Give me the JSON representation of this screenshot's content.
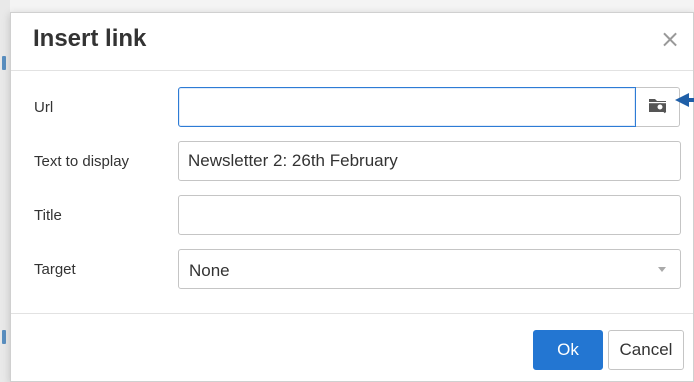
{
  "dialog": {
    "title": "Insert link",
    "close_symbol": "×"
  },
  "form": {
    "url": {
      "label": "Url",
      "value": "",
      "browse_icon": "folder-search-icon"
    },
    "text_to_display": {
      "label": "Text to display",
      "value": "Newsletter 2: 26th February"
    },
    "title": {
      "label": "Title",
      "value": ""
    },
    "target": {
      "label": "Target",
      "selected": "None"
    }
  },
  "buttons": {
    "ok": "Ok",
    "cancel": "Cancel"
  },
  "colors": {
    "primary": "#2376d2",
    "focus_border": "#2d7bd5",
    "annotation_arrow": "#1f5fa8"
  }
}
